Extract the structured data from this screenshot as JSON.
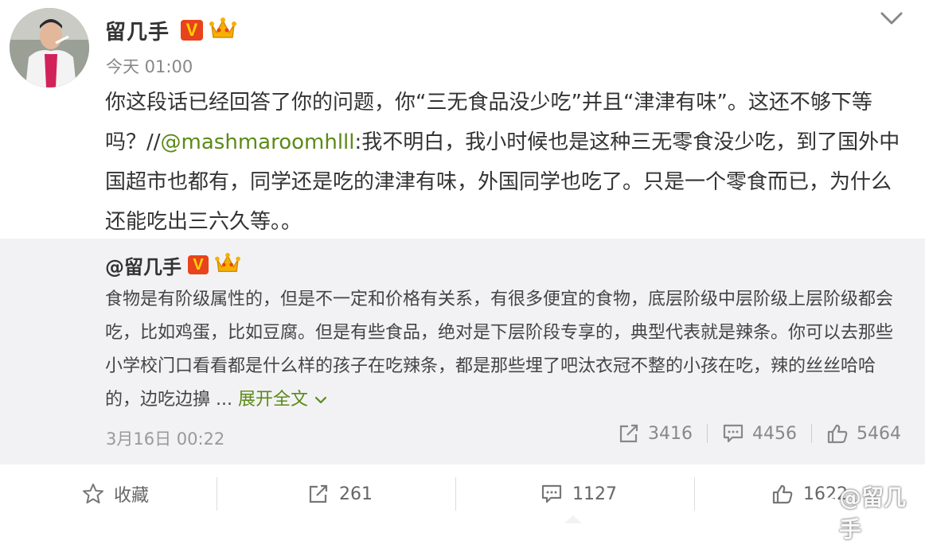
{
  "post": {
    "author": "留几手",
    "verified_badge": "V",
    "time": "今天 01:00",
    "text_before_mention": "你这段话已经回答了你的问题，你“三无食品没少吃”并且“津津有味”。这还不够下等吗？//",
    "mention": "@mashmaroomhlll",
    "text_after_mention": ":我不明白，我小时候也是这种三无零食没少吃，到了国外中国超市也都有，同学还是吃的津津有味，外国同学也吃了。只是一个零食而已，为什么还能吃出三六久等。。"
  },
  "repost": {
    "author": "@留几手",
    "verified_badge": "V",
    "text": "食物是有阶级属性的，但是不一定和价格有关系，有很多便宜的食物，底层阶级中层阶级上层阶级都会吃，比如鸡蛋，比如豆腐。但是有些食品，绝对是下层阶段专享的，典型代表就是辣条。你可以去那些小学校门口看看都是什么样的孩子在吃辣条，都是那些埋了吧汰衣冠不整的小孩在吃，辣的丝丝哈哈的，边吃边擤 ...",
    "expand_label": "展开全文",
    "date": "3月16日 00:22",
    "reposts": "3416",
    "comments": "4456",
    "likes": "5464"
  },
  "actions": {
    "favorite_label": "收藏",
    "repost_count": "261",
    "comment_count": "1127",
    "like_count": "1622"
  },
  "watermark": "@留几手",
  "colors": {
    "link_green": "#5b8a17",
    "badge_red": "#e8431c",
    "badge_yellow": "#ffd400",
    "repost_bg": "#f2f2f5"
  },
  "icons": [
    "vip-v-badge-icon",
    "crown-icon",
    "chevron-down-icon",
    "repost-icon",
    "comment-icon",
    "like-icon",
    "star-icon",
    "weibo-logo-icon"
  ]
}
